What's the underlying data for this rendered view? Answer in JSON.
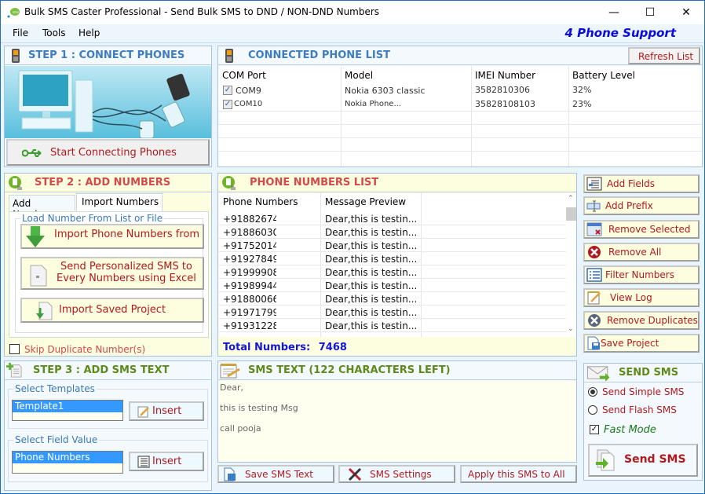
{
  "window": {
    "title": "Bulk SMS Caster Professional - Send Bulk SMS to DND / NON-DND Numbers",
    "controls": {
      "minimize": "—",
      "maximize": "☐",
      "close": "✕"
    }
  },
  "menu": {
    "items": [
      "File",
      "Tools",
      "Help"
    ],
    "support_text": "4 Phone Support"
  },
  "step1": {
    "title": "STEP 1 : CONNECT PHONES",
    "connect_button": "Start Connecting Phones"
  },
  "connected": {
    "title": "CONNECTED PHONE LIST",
    "refresh_button": "Refresh List",
    "columns": [
      "COM  Port",
      "Model",
      "IMEI Number",
      "Battery Level"
    ],
    "rows": [
      {
        "checked": true,
        "port": "COM9",
        "model": "Nokia 6303 classic",
        "imei": "3582810306",
        "battery": "32%"
      },
      {
        "checked": true,
        "port": "COM10",
        "model": "Nokia Phone...",
        "imei": "35828108103",
        "battery": "23%"
      }
    ]
  },
  "step2": {
    "title": "STEP 2 : ADD NUMBERS",
    "tabs": [
      "Add Numbers",
      "Import Numbers"
    ],
    "active_tab": "Import Numbers",
    "group_label": "Load Number From List or File",
    "buttons": {
      "import_phone": "Import Phone Numbers from",
      "personalized_line1": "Send Personalized SMS to",
      "personalized_line2": "Every Numbers using Excel",
      "import_project": "Import Saved Project"
    },
    "skip_duplicates_label": "Skip Duplicate Number(s)",
    "skip_duplicates_checked": false
  },
  "numbers": {
    "title": "PHONE NUMBERS LIST",
    "columns": [
      "Phone Numbers",
      "Message Preview"
    ],
    "rows": [
      {
        "phone": "+91882674",
        "preview": "Dear,this is testin..."
      },
      {
        "phone": "+91886030",
        "preview": "Dear,this is testin..."
      },
      {
        "phone": "+91752014",
        "preview": "Dear,this is testin..."
      },
      {
        "phone": "+91927849",
        "preview": "Dear,this is testin..."
      },
      {
        "phone": "+91999908",
        "preview": "Dear,this is testin..."
      },
      {
        "phone": "+91989944",
        "preview": "Dear,this is testin..."
      },
      {
        "phone": "+91880066",
        "preview": "Dear,this is testin..."
      },
      {
        "phone": "+91971799",
        "preview": "Dear,this is testin..."
      },
      {
        "phone": "+91931228",
        "preview": "Dear,this is testin..."
      }
    ],
    "total_label": "Total Numbers:",
    "total_value": "7468"
  },
  "side_actions": [
    {
      "label": "Add Fields",
      "icon": "add-fields-icon"
    },
    {
      "label": "Add Prefix",
      "icon": "add-prefix-icon"
    },
    {
      "label": "Remove Selected",
      "icon": "remove-selected-icon"
    },
    {
      "label": "Remove All",
      "icon": "remove-all-icon"
    },
    {
      "label": "Filter Numbers",
      "icon": "filter-numbers-icon"
    },
    {
      "label": "View Log",
      "icon": "view-log-icon"
    },
    {
      "label": "Remove Duplicates",
      "icon": "remove-duplicates-icon"
    },
    {
      "label": "Save Project",
      "icon": "save-project-icon"
    }
  ],
  "step3": {
    "title": "STEP 3 : ADD SMS TEXT",
    "templates_label": "Select Templates",
    "template_selected": "Template1",
    "insert_template": "Insert",
    "field_label": "Select Field Value",
    "field_selected": "Phone Numbers",
    "insert_field": "Insert"
  },
  "sms_text": {
    "title": "SMS TEXT (122 CHARACTERS LEFT)",
    "lines": [
      "Dear,",
      "this is testing Msg",
      "call pooja"
    ],
    "save_button": "Save SMS Text",
    "settings_button": "SMS Settings",
    "apply_button": "Apply this SMS to All"
  },
  "send": {
    "title": "SEND SMS",
    "options": [
      "Send Simple SMS",
      "Send Flash SMS"
    ],
    "selected_option": "Send Simple SMS",
    "fast_mode_label": "Fast Mode",
    "fast_mode_checked": true,
    "send_button": "Send SMS"
  },
  "colors": {
    "step1_title": "#3e7cc0",
    "step2_title": "#d34a4a",
    "step3_title": "#5e8a1a",
    "button_text": "#b2191d",
    "total_text": "#1515d6",
    "support_text": "#0a0adc",
    "selection": "#3399ff"
  }
}
